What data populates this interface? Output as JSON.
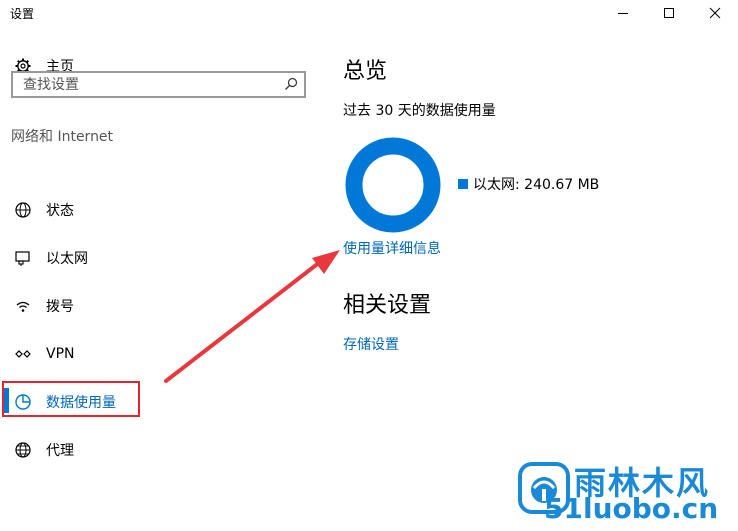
{
  "window": {
    "title": "设置",
    "controls": {
      "minimize": "minimize-icon",
      "maximize": "maximize-icon",
      "close": "close-icon"
    }
  },
  "sidebar": {
    "home_label": "主页",
    "search_placeholder": "查找设置",
    "section_title": "网络和 Internet",
    "items": [
      {
        "label": "状态",
        "icon": "globe-status-icon"
      },
      {
        "label": "以太网",
        "icon": "ethernet-icon"
      },
      {
        "label": "拨号",
        "icon": "dialup-icon"
      },
      {
        "label": "VPN",
        "icon": "vpn-icon"
      },
      {
        "label": "数据使用量",
        "icon": "data-usage-icon",
        "selected": true
      },
      {
        "label": "代理",
        "icon": "globe-proxy-icon"
      }
    ]
  },
  "main": {
    "title": "总览",
    "subtitle": "过去 30 天的数据使用量",
    "legend_label": "以太网: 240.67 MB",
    "details_link": "使用量详细信息",
    "related_title": "相关设置",
    "storage_link": "存储设置"
  },
  "chart_data": {
    "type": "pie",
    "categories": [
      "以太网"
    ],
    "values": [
      240.67
    ],
    "unit": "MB",
    "legend": [
      "以太网: 240.67 MB"
    ]
  },
  "watermark": {
    "chinese": "雨林木风",
    "domain": "51luobo.cn"
  },
  "colors": {
    "accent": "#0078d7",
    "link": "#0067b8",
    "highlight_box": "#e3262e",
    "arrow": "#e8383d"
  }
}
